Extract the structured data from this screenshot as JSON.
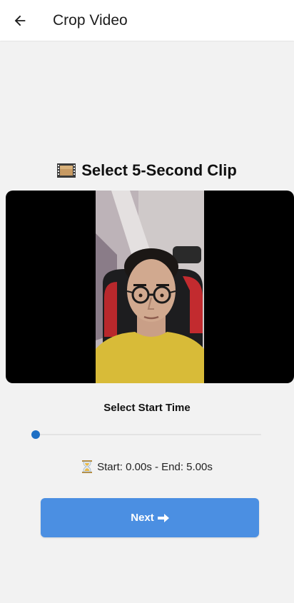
{
  "appbar": {
    "title": "Crop Video",
    "back_icon": "arrow-left-icon"
  },
  "clip_section": {
    "title": "Select 5-Second Clip",
    "title_icon": "film-frames-icon"
  },
  "video": {
    "frame_color": "#000000"
  },
  "slider": {
    "label": "Select Start Time",
    "value_fraction": 0.0,
    "thumb_color": "#1e6fc4"
  },
  "time_info": {
    "icon": "hourglass-icon",
    "text": "Start: 0.00s - End: 5.00s"
  },
  "next_button": {
    "label": "Next",
    "icon": "arrow-right-icon",
    "color": "#4b8fe2"
  }
}
